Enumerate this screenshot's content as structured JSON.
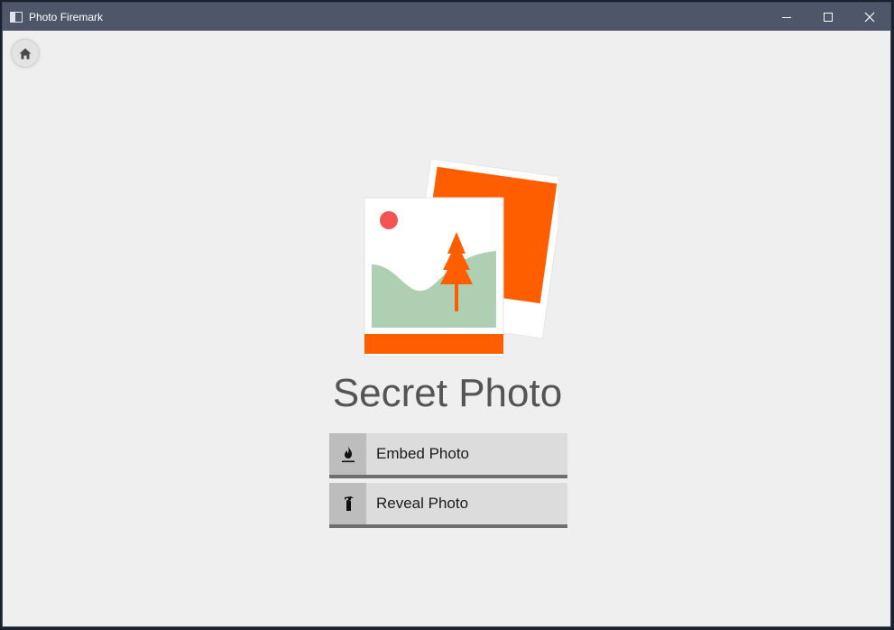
{
  "window": {
    "title": "Photo Firemark",
    "controls": {
      "minimize": "minimize-icon",
      "maximize": "maximize-icon",
      "close": "close-icon"
    }
  },
  "nav": {
    "home_icon": "home-icon"
  },
  "hero": {
    "icon": "photo-stack-icon",
    "colors": {
      "accent": "#ff5e00",
      "sun": "#f25454",
      "hill": "#aecfb1",
      "frame": "#ffffff"
    }
  },
  "main": {
    "app_name": "Secret Photo",
    "actions": [
      {
        "label": "Embed Photo",
        "icon": "flame-icon"
      },
      {
        "label": "Reveal Photo",
        "icon": "fire-extinguisher-icon"
      }
    ]
  }
}
